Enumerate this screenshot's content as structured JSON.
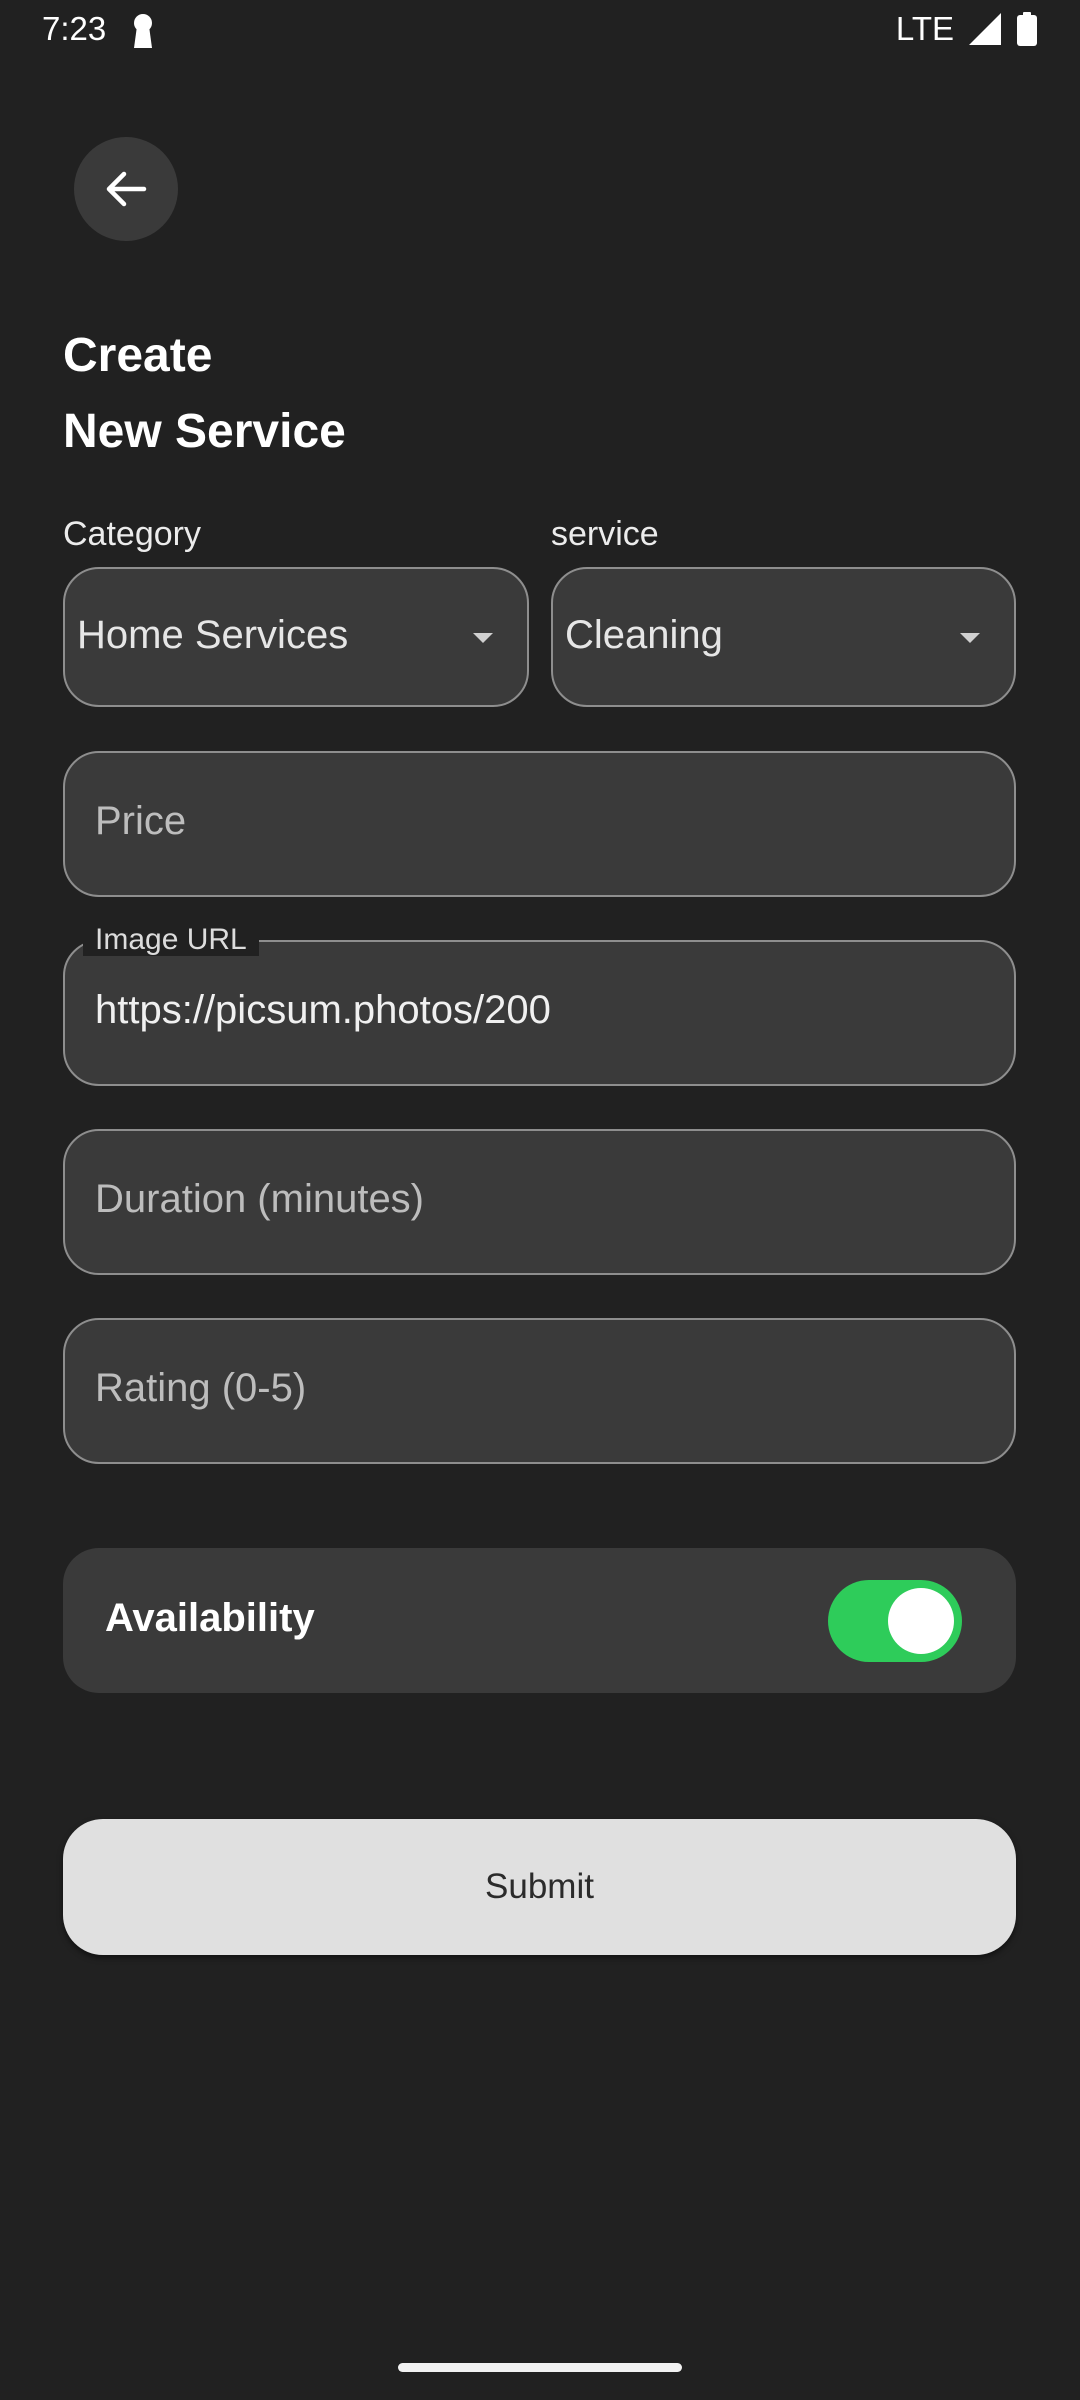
{
  "status_bar": {
    "time": "7:23",
    "network": "LTE",
    "icons": [
      "keyhole-icon",
      "signal-icon",
      "battery-icon"
    ]
  },
  "header": {
    "back_icon": "arrow-left-icon",
    "title_line1": "Create",
    "title_line2": "New Service"
  },
  "form": {
    "category": {
      "label": "Category",
      "value": "Home Services"
    },
    "service": {
      "label": "service",
      "value": "Cleaning"
    },
    "price": {
      "placeholder": "Price",
      "value": ""
    },
    "image_url": {
      "label": "Image URL",
      "value": "https://picsum.photos/200"
    },
    "duration": {
      "placeholder": "Duration (minutes)",
      "value": ""
    },
    "rating": {
      "placeholder": "Rating (0-5)",
      "value": ""
    },
    "availability": {
      "label": "Availability",
      "enabled": true,
      "toggle_color": "#2ecc5a"
    },
    "submit_label": "Submit"
  },
  "colors": {
    "background": "#212121",
    "field_background": "#3a3a3a",
    "button_background": "#e0e0e0"
  }
}
